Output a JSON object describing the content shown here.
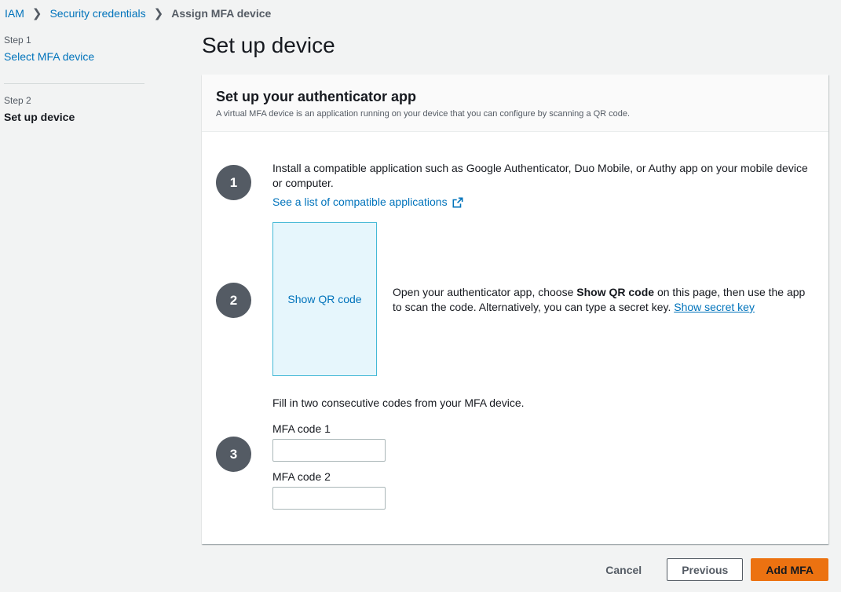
{
  "breadcrumb": {
    "items": [
      "IAM",
      "Security credentials",
      "Assign MFA device"
    ]
  },
  "steps": [
    {
      "num": "Step 1",
      "name": "Select MFA device"
    },
    {
      "num": "Step 2",
      "name": "Set up device"
    }
  ],
  "page_title": "Set up device",
  "panel": {
    "title": "Set up your authenticator app",
    "description": "A virtual MFA device is an application running on your device that you can configure by scanning a QR code."
  },
  "step1": {
    "number": "1",
    "text": "Install a compatible application such as Google Authenticator, Duo Mobile, or Authy app on your mobile device or computer.",
    "link": "See a list of compatible applications"
  },
  "step2": {
    "number": "2",
    "qr_label": "Show QR code",
    "text_before": "Open your authenticator app, choose ",
    "text_bold": "Show QR code",
    "text_after": " on this page, then use the app to scan the code. Alternatively, you can type a secret key. ",
    "secret_link": "Show secret key"
  },
  "step3": {
    "number": "3",
    "intro": "Fill in two consecutive codes from your MFA device.",
    "code1_label": "MFA code 1",
    "code1_value": "",
    "code2_label": "MFA code 2",
    "code2_value": ""
  },
  "actions": {
    "cancel": "Cancel",
    "previous": "Previous",
    "add": "Add MFA"
  },
  "colors": {
    "link": "#0073bb",
    "primary_button": "#ec7211",
    "step_circle": "#545b64",
    "qr_background": "#e6f6fc"
  }
}
